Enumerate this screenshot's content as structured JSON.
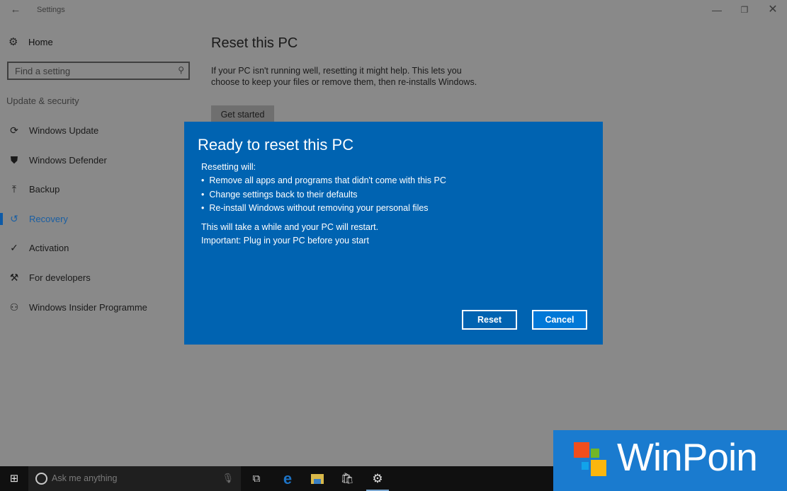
{
  "window": {
    "title": "Settings",
    "back_icon": "←",
    "minimize_icon": "—",
    "maximize_icon": "❐",
    "close_icon": "✕"
  },
  "sidebar": {
    "home": {
      "icon": "⚙",
      "label": "Home"
    },
    "search": {
      "placeholder": "Find a setting",
      "icon": "⚲"
    },
    "section_title": "Update & security",
    "items": [
      {
        "icon": "⟳",
        "label": "Windows Update",
        "active": false
      },
      {
        "icon": "⛊",
        "label": "Windows Defender",
        "active": false
      },
      {
        "icon": "⤒",
        "label": "Backup",
        "active": false
      },
      {
        "icon": "↺",
        "label": "Recovery",
        "active": true
      },
      {
        "icon": "✓",
        "label": "Activation",
        "active": false
      },
      {
        "icon": "⚒",
        "label": "For developers",
        "active": false
      },
      {
        "icon": "⚇",
        "label": "Windows Insider Programme",
        "active": false
      }
    ]
  },
  "main": {
    "title": "Reset this PC",
    "description": "If your PC isn't running well, resetting it might help. This lets you choose to keep your files or remove them, then re-installs Windows.",
    "get_started_label": "Get started"
  },
  "dialog": {
    "title": "Ready to reset this PC",
    "intro": "Resetting will:",
    "bullets": [
      "Remove all apps and programs that didn't come with this PC",
      "Change settings back to their defaults",
      "Re-install Windows without removing your personal files"
    ],
    "note1": "This will take a while and your PC will restart.",
    "note2": "Important: Plug in your PC before you start",
    "reset_label": "Reset",
    "cancel_label": "Cancel",
    "background_color": "#0063b1"
  },
  "taskbar": {
    "start_icon": "⊞",
    "search_placeholder": "Ask me anything",
    "mic_icon": "🎙",
    "task_view_icon": "⧉",
    "edge_icon": "e",
    "store_icon": "🛍",
    "settings_icon": "⚙"
  },
  "watermark": {
    "text": "WinPoin"
  }
}
